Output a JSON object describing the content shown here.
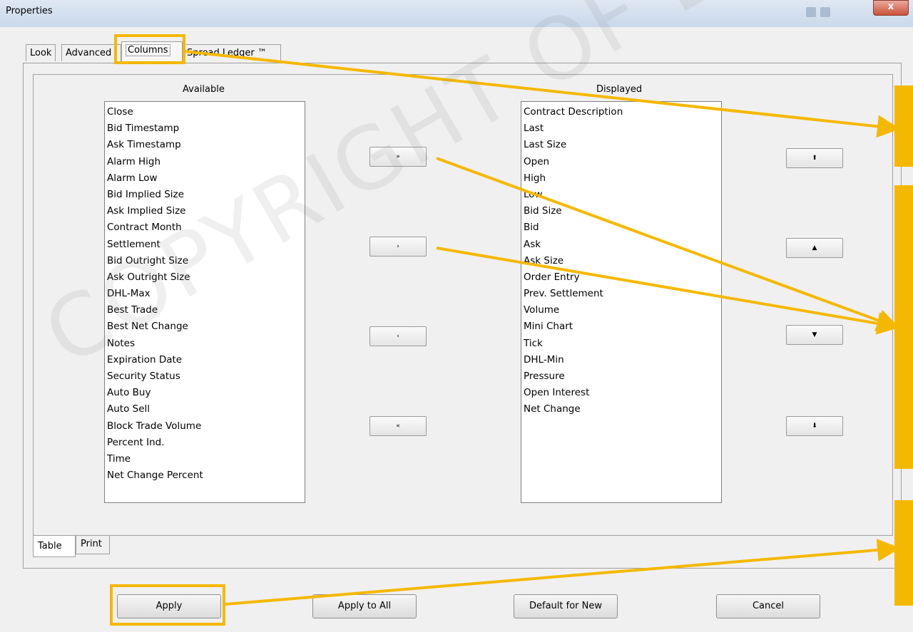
{
  "window": {
    "title": "Properties",
    "close_glyph": "x"
  },
  "tabs": [
    "Look",
    "Advanced",
    "Columns",
    "Spread Ledger ™"
  ],
  "active_tab": "Columns",
  "available": {
    "label": "Available",
    "items": [
      "Close",
      "Bid Timestamp",
      "Ask Timestamp",
      "Alarm High",
      "Alarm Low",
      "Bid Implied Size",
      "Ask Implied Size",
      "Contract Month",
      "Settlement",
      "Bid Outright Size",
      "Ask Outright Size",
      "DHL-Max",
      "Best Trade",
      "Best Net Change",
      "Notes",
      "Expiration Date",
      "Security Status",
      "Auto Buy",
      "Auto Sell",
      "Block Trade Volume",
      "Percent Ind.",
      "Time",
      "Net Change Percent"
    ]
  },
  "displayed": {
    "label": "Displayed",
    "items": [
      "Contract Description",
      "Last",
      "Last Size",
      "Open",
      "High",
      "Low",
      "Bid Size",
      "Bid",
      "Ask",
      "Ask Size",
      "Order Entry",
      "Prev. Settlement",
      "Volume",
      "Mini Chart",
      "Tick",
      "DHL-Min",
      "Pressure",
      "Open Interest",
      "Net Change"
    ]
  },
  "move_buttons": {
    "add_all": "»",
    "add": "›",
    "remove": "‹",
    "remove_all": "«"
  },
  "order_buttons": {
    "top": "⬆",
    "up": "▲",
    "down": "▼",
    "bottom": "⬇"
  },
  "bottom_tabs": [
    "Table",
    "Print"
  ],
  "active_bottom_tab": "Table",
  "buttons": {
    "apply": "Apply",
    "apply_all": "Apply to All",
    "default_new": "Default for New",
    "cancel": "Cancel"
  },
  "watermark": "COPYRIGHT OF BULB INVESTMENTS",
  "highlight_color": "#f5b800"
}
